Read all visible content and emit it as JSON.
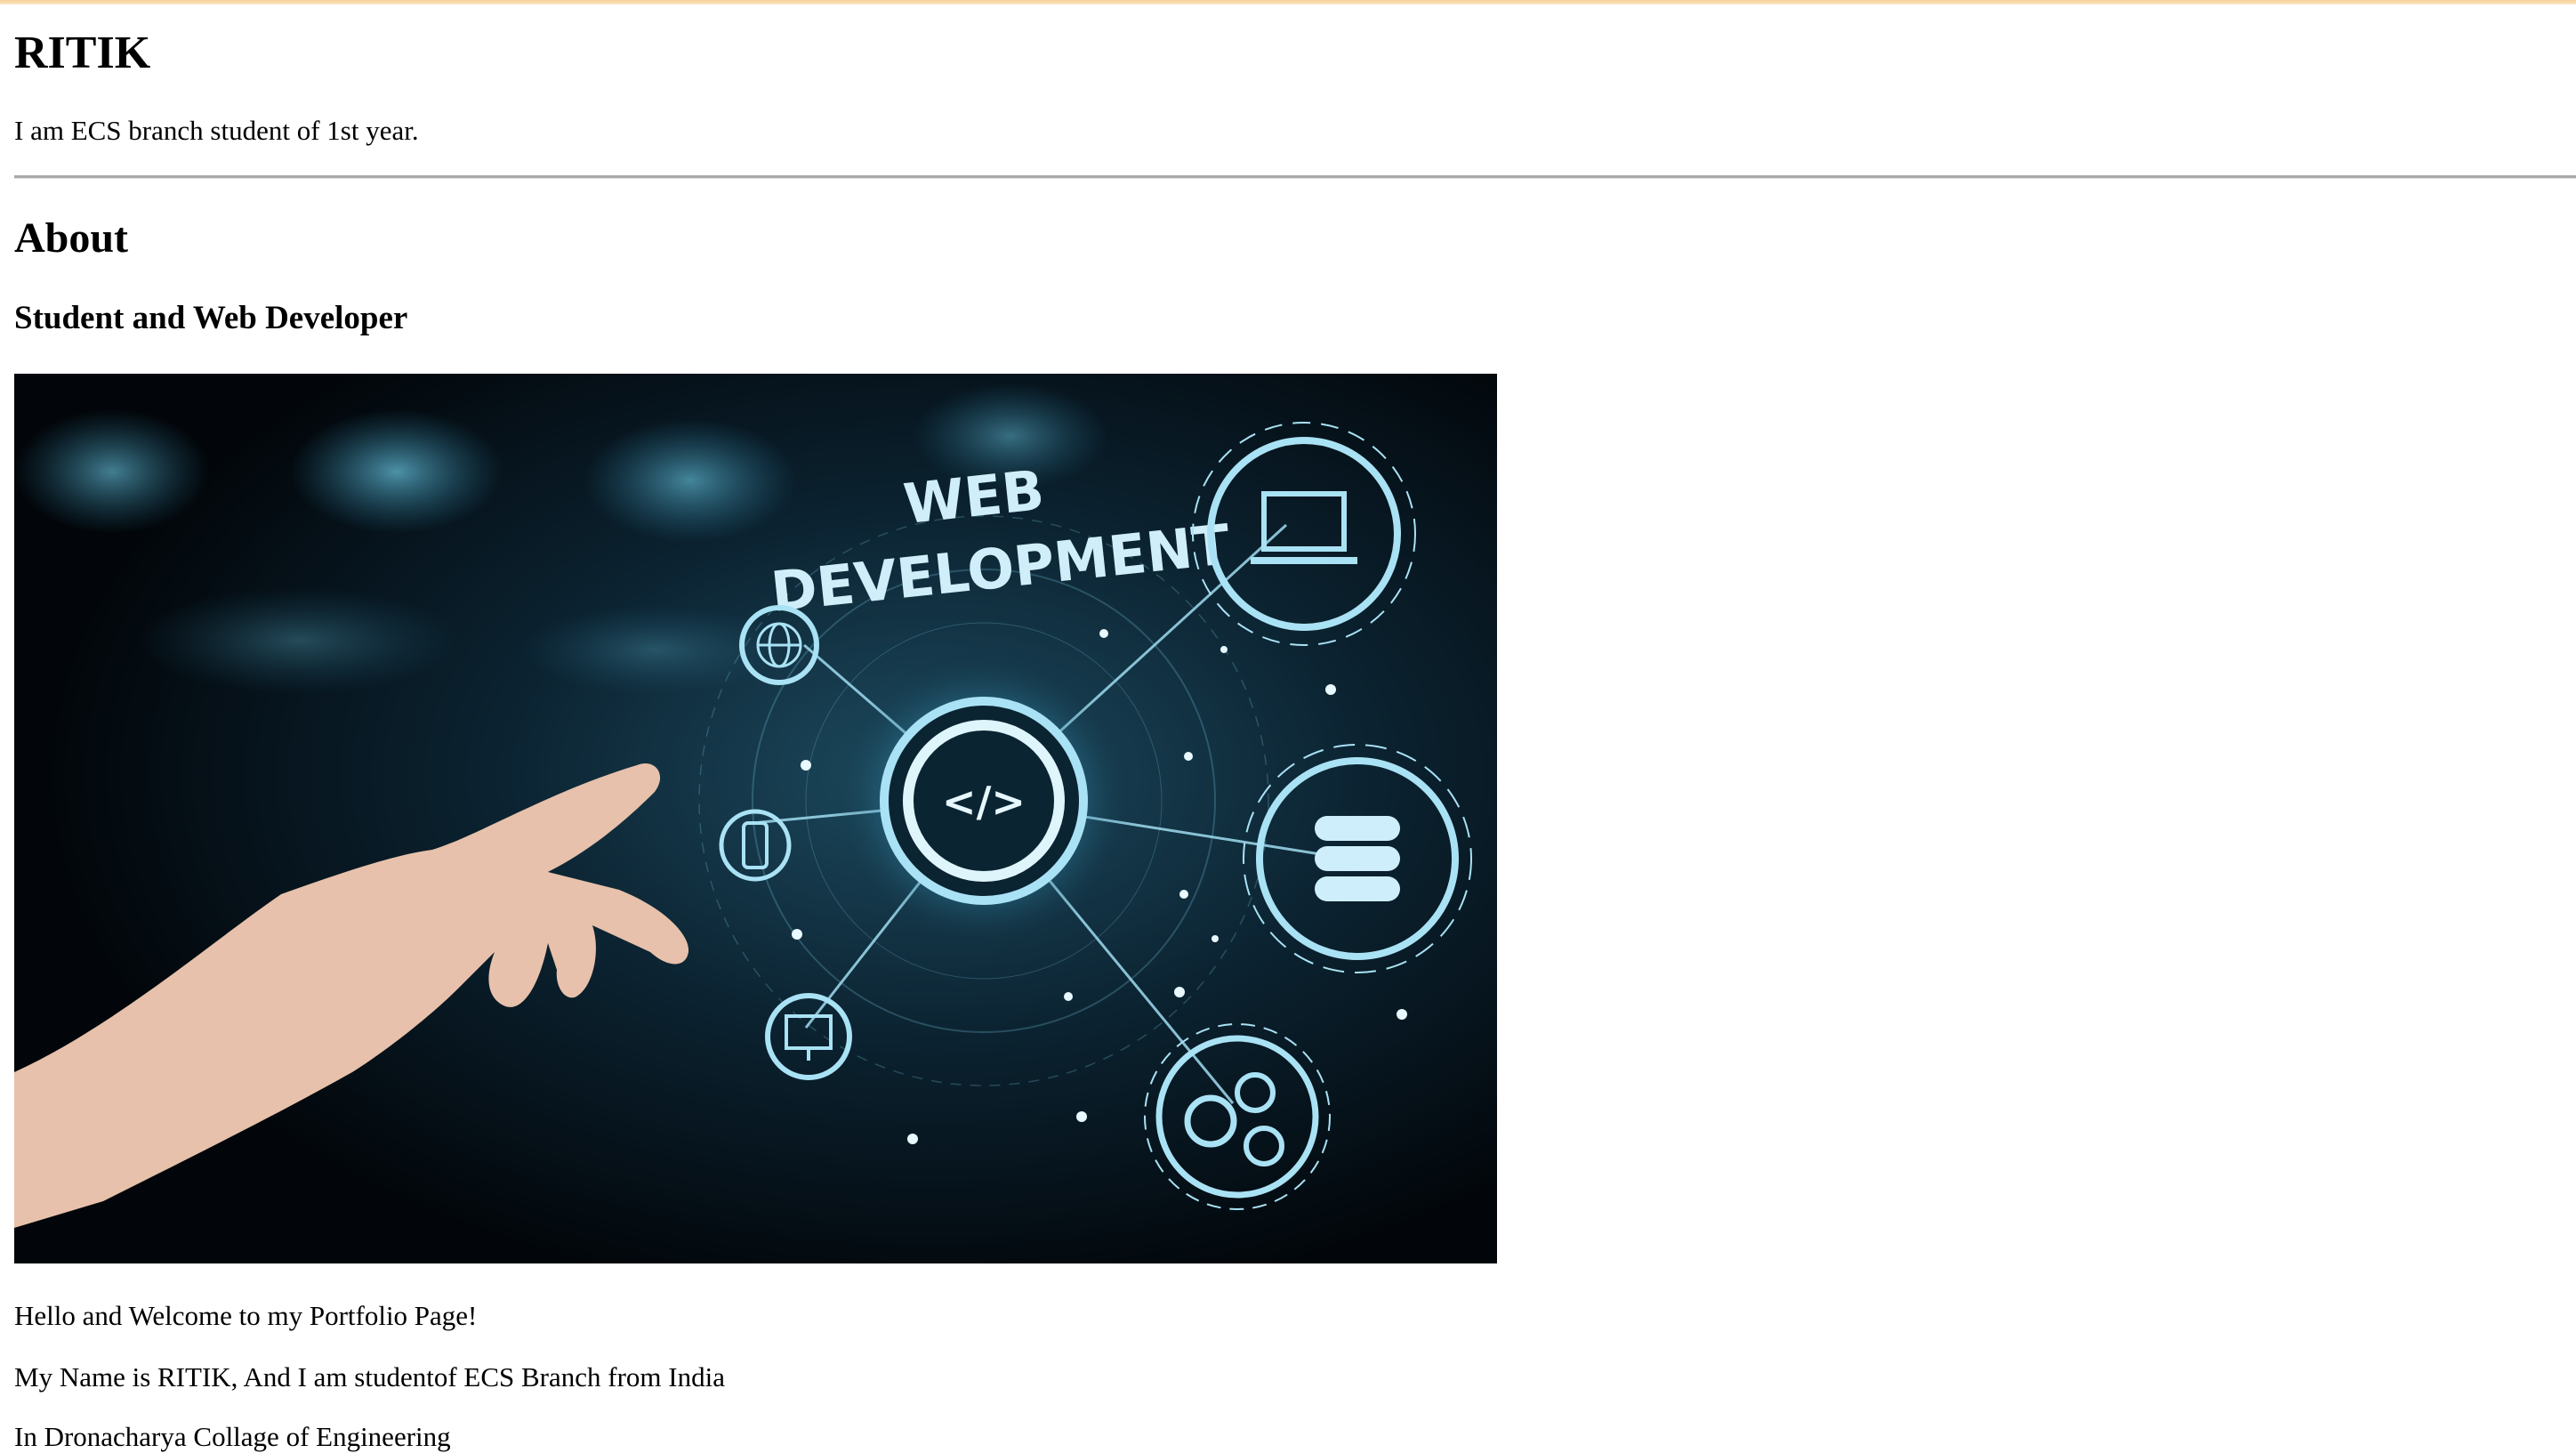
{
  "page": {
    "title": "RITIK",
    "tagline": "I am ECS branch student of 1st year."
  },
  "about": {
    "heading": "About",
    "subheading": "Student and Web Developer"
  },
  "hero_image": {
    "line1": "WEB",
    "line2": "DEVELOPMENT",
    "icons": [
      "globe-icon",
      "laptop-icon",
      "phone-icon",
      "code-sync-icon",
      "database-icon",
      "monitor-icon",
      "gears-icon"
    ],
    "accent": "#8fd3ec",
    "background": "#04080b"
  },
  "intro": {
    "line1": "Hello and Welcome to my Portfolio Page!",
    "line2": "My Name is RITIK, And I am studentof ECS Branch from India",
    "line3": "In Dronacharya Collage of Engineering"
  }
}
